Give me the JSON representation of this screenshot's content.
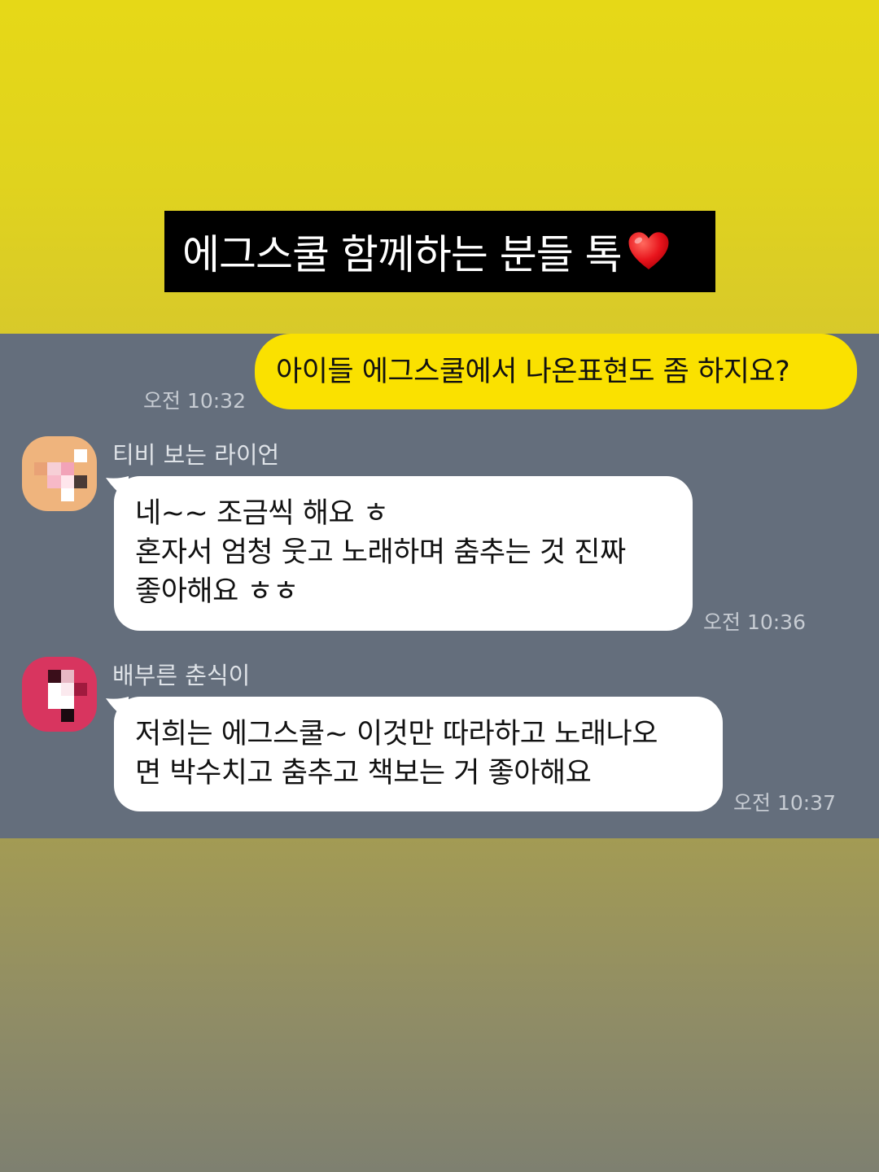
{
  "title": {
    "text": "에그스쿨 함께하는 분들 톡",
    "emoji": "heart-icon"
  },
  "colors": {
    "my_bubble": "#fae100",
    "other_bubble": "#ffffff",
    "chat_background": "#646e7c",
    "title_background": "#000000"
  },
  "messages": [
    {
      "from": "me",
      "text": "아이들 에그스쿨에서 나온표현도 좀 하지요?",
      "time": "오전 10:32"
    },
    {
      "from": "other",
      "sender": "티비 보는 라이언",
      "lines": [
        "네~~ 조금씩 해요 ㅎ",
        "혼자서 엄청 웃고 노래하며 춤추는 것 진짜",
        "좋아해요 ㅎㅎ"
      ],
      "time": "오전 10:36"
    },
    {
      "from": "other",
      "sender": "배부른 춘식이",
      "lines": [
        "저희는 에그스쿨~ 이것만 따라하고 노래나오",
        "면 박수치고 춤추고 책보는 거 좋아해요"
      ],
      "time": "오전 10:37"
    }
  ]
}
